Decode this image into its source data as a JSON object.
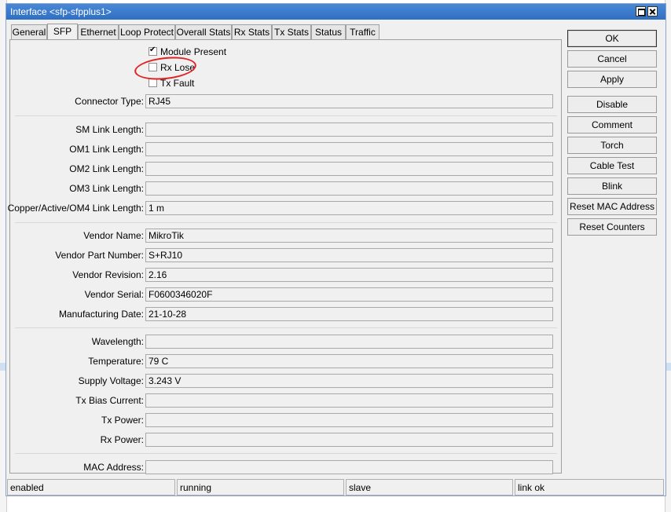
{
  "window": {
    "title": "Interface <sfp-sfpplus1>"
  },
  "tabs": [
    "General",
    "SFP",
    "Ethernet",
    "Loop Protect",
    "Overall Stats",
    "Rx Stats",
    "Tx Stats",
    "Status",
    "Traffic"
  ],
  "active_tab": "SFP",
  "checkboxes": {
    "module_present": {
      "label": "Module Present",
      "checked": true
    },
    "rx_lose": {
      "label": "Rx Lose",
      "checked": false
    },
    "tx_fault": {
      "label": "Tx Fault",
      "checked": false
    }
  },
  "fields": {
    "connector_type": {
      "label": "Connector Type:",
      "value": "RJ45"
    },
    "sm_link_length": {
      "label": "SM Link Length:",
      "value": ""
    },
    "om1_link_length": {
      "label": "OM1 Link Length:",
      "value": ""
    },
    "om2_link_length": {
      "label": "OM2 Link Length:",
      "value": ""
    },
    "om3_link_length": {
      "label": "OM3 Link Length:",
      "value": ""
    },
    "copper_link_length": {
      "label": "Copper/Active/OM4 Link Length:",
      "value": "1 m"
    },
    "vendor_name": {
      "label": "Vendor Name:",
      "value": "MikroTik"
    },
    "vendor_part_number": {
      "label": "Vendor Part Number:",
      "value": "S+RJ10"
    },
    "vendor_revision": {
      "label": "Vendor Revision:",
      "value": "2.16"
    },
    "vendor_serial": {
      "label": "Vendor Serial:",
      "value": "F0600346020F"
    },
    "manufacturing_date": {
      "label": "Manufacturing Date:",
      "value": "21-10-28"
    },
    "wavelength": {
      "label": "Wavelength:",
      "value": ""
    },
    "temperature": {
      "label": "Temperature:",
      "value": "79 C"
    },
    "supply_voltage": {
      "label": "Supply Voltage:",
      "value": "3.243 V"
    },
    "tx_bias_current": {
      "label": "Tx Bias Current:",
      "value": ""
    },
    "tx_power": {
      "label": "Tx Power:",
      "value": ""
    },
    "rx_power": {
      "label": "Rx Power:",
      "value": ""
    },
    "mac_address": {
      "label": "MAC Address:",
      "value": ""
    }
  },
  "buttons": {
    "ok": "OK",
    "cancel": "Cancel",
    "apply": "Apply",
    "disable": "Disable",
    "comment": "Comment",
    "torch": "Torch",
    "cable_test": "Cable Test",
    "blink": "Blink",
    "reset_mac": "Reset MAC Address",
    "reset_counters": "Reset Counters"
  },
  "status": [
    "enabled",
    "running",
    "slave",
    "link ok"
  ],
  "colors": {
    "titlebar": "#3a7bd0",
    "annotation": "#e22222"
  }
}
